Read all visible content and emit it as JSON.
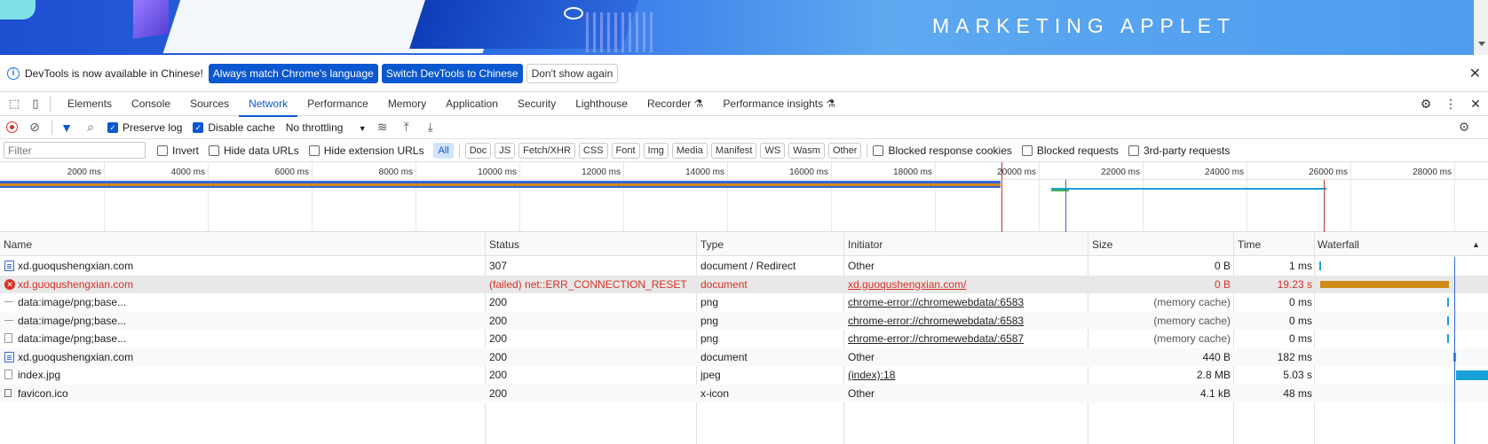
{
  "banner": {
    "title": "MARKETING APPLET"
  },
  "infobar": {
    "message": "DevTools is now available in Chinese!",
    "btn_match": "Always match Chrome's language",
    "btn_switch": "Switch DevTools to Chinese",
    "btn_dont_show": "Don't show again",
    "close_icon": "close-icon"
  },
  "tabs": [
    {
      "label": "Elements"
    },
    {
      "label": "Console"
    },
    {
      "label": "Sources"
    },
    {
      "label": "Network"
    },
    {
      "label": "Performance"
    },
    {
      "label": "Memory"
    },
    {
      "label": "Application"
    },
    {
      "label": "Security"
    },
    {
      "label": "Lighthouse"
    },
    {
      "label": "Recorder"
    },
    {
      "label": "Performance insights"
    }
  ],
  "active_tab": "Network",
  "toolbar": {
    "preserve_log": "Preserve log",
    "disable_cache": "Disable cache",
    "throttling": "No throttling"
  },
  "filter": {
    "placeholder": "Filter",
    "invert": "Invert",
    "hide_data_urls": "Hide data URLs",
    "hide_ext_urls": "Hide extension URLs",
    "types": [
      "All",
      "Doc",
      "JS",
      "Fetch/XHR",
      "CSS",
      "Font",
      "Img",
      "Media",
      "Manifest",
      "WS",
      "Wasm",
      "Other"
    ],
    "blocked_cookies": "Blocked response cookies",
    "blocked_requests": "Blocked requests",
    "third_party": "3rd-party requests"
  },
  "overview": {
    "ticks": [
      "2000 ms",
      "4000 ms",
      "6000 ms",
      "8000 ms",
      "10000 ms",
      "12000 ms",
      "14000 ms",
      "16000 ms",
      "18000 ms",
      "20000 ms",
      "22000 ms",
      "24000 ms",
      "26000 ms",
      "28000 ms"
    ]
  },
  "columns": {
    "name": "Name",
    "status": "Status",
    "type": "Type",
    "initiator": "Initiator",
    "size": "Size",
    "time": "Time",
    "waterfall": "Waterfall"
  },
  "rows": [
    {
      "name": "xd.guoqushengxian.com",
      "status": "307",
      "type": "document / Redirect",
      "initiator": "Other",
      "size": "0 B",
      "time": "1 ms"
    },
    {
      "name": "xd.guoqushengxian.com",
      "status": "(failed) net::ERR_CONNECTION_RESET",
      "type": "document",
      "initiator": "xd.guoqushengxian.com/",
      "size": "0 B",
      "time": "19.23 s"
    },
    {
      "name": "data:image/png;base...",
      "status": "200",
      "type": "png",
      "initiator": "chrome-error://chromewebdata/:6583",
      "size": "(memory cache)",
      "time": "0 ms"
    },
    {
      "name": "data:image/png;base...",
      "status": "200",
      "type": "png",
      "initiator": "chrome-error://chromewebdata/:6583",
      "size": "(memory cache)",
      "time": "0 ms"
    },
    {
      "name": "data:image/png;base...",
      "status": "200",
      "type": "png",
      "initiator": "chrome-error://chromewebdata/:6587",
      "size": "(memory cache)",
      "time": "0 ms"
    },
    {
      "name": "xd.guoqushengxian.com",
      "status": "200",
      "type": "document",
      "initiator": "Other",
      "size": "440 B",
      "time": "182 ms"
    },
    {
      "name": "index.jpg",
      "status": "200",
      "type": "jpeg",
      "initiator": "(index):18",
      "size": "2.8 MB",
      "time": "5.03 s"
    },
    {
      "name": "favicon.ico",
      "status": "200",
      "type": "x-icon",
      "initiator": "Other",
      "size": "4.1 kB",
      "time": "48 ms"
    }
  ]
}
